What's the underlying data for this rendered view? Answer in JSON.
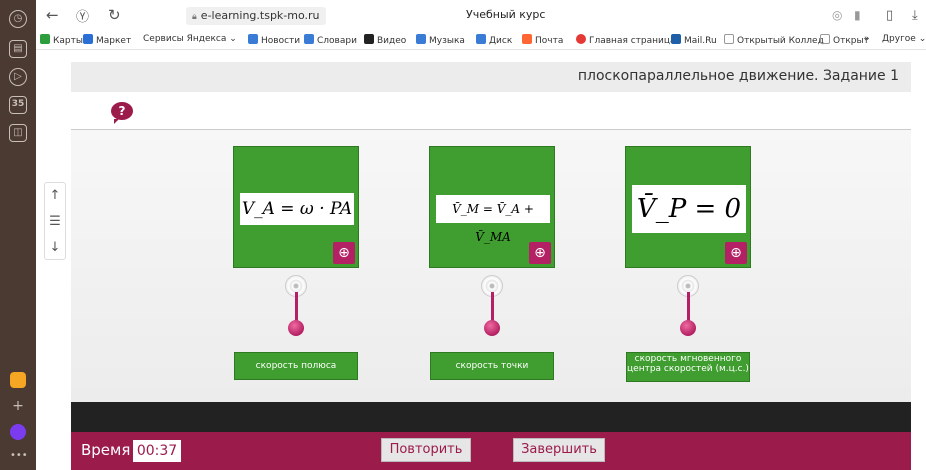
{
  "browser": {
    "address": "e-learning.tspk-mo.ru",
    "tab_title": "Учебный курс",
    "rail_badge": "35",
    "bookmarks": [
      {
        "label": "Карты",
        "color": "#2e9d3c"
      },
      {
        "label": "Маркет",
        "color": "#2a6fd6"
      },
      {
        "label": "Сервисы Яндекса ⌄",
        "color": ""
      },
      {
        "label": "Новости",
        "color": "#3a7bd5"
      },
      {
        "label": "Словари",
        "color": "#3a7bd5"
      },
      {
        "label": "Видео",
        "color": "#222222"
      },
      {
        "label": "Музыка",
        "color": "#3a7bd5"
      },
      {
        "label": "Диск",
        "color": "#3a7bd5"
      },
      {
        "label": "Почта",
        "color": "#ff6633"
      },
      {
        "label": "Главная страница",
        "color": "#e53935"
      },
      {
        "label": "Mail.Ru",
        "color": "#1e5fa8"
      },
      {
        "label": "Открытый Коллед",
        "color": "#999999"
      },
      {
        "label": "Открыт",
        "color": "#999999"
      },
      {
        "label": "»",
        "color": ""
      },
      {
        "label": "Другое ⌄",
        "color": ""
      }
    ]
  },
  "lesson": {
    "title": "плоскопараллельное движение. Задание 1",
    "help_symbol": "?",
    "cards": [
      {
        "formula": "V_A = ω · PA",
        "label": "скорость полюса"
      },
      {
        "formula": "V̄_M = V̄_A + V̄_MA",
        "label": "скорость точки"
      },
      {
        "formula": "V̄_P = 0",
        "label": "скорость мгновенного центра скоростей (м.ц.с.)"
      }
    ],
    "time_label": "Время",
    "time_value": "00:37",
    "repeat_button": "Повторить",
    "finish_button": "Завершить"
  },
  "colors": {
    "accent": "#9b1b4b",
    "card_green": "#3f9e2f"
  }
}
